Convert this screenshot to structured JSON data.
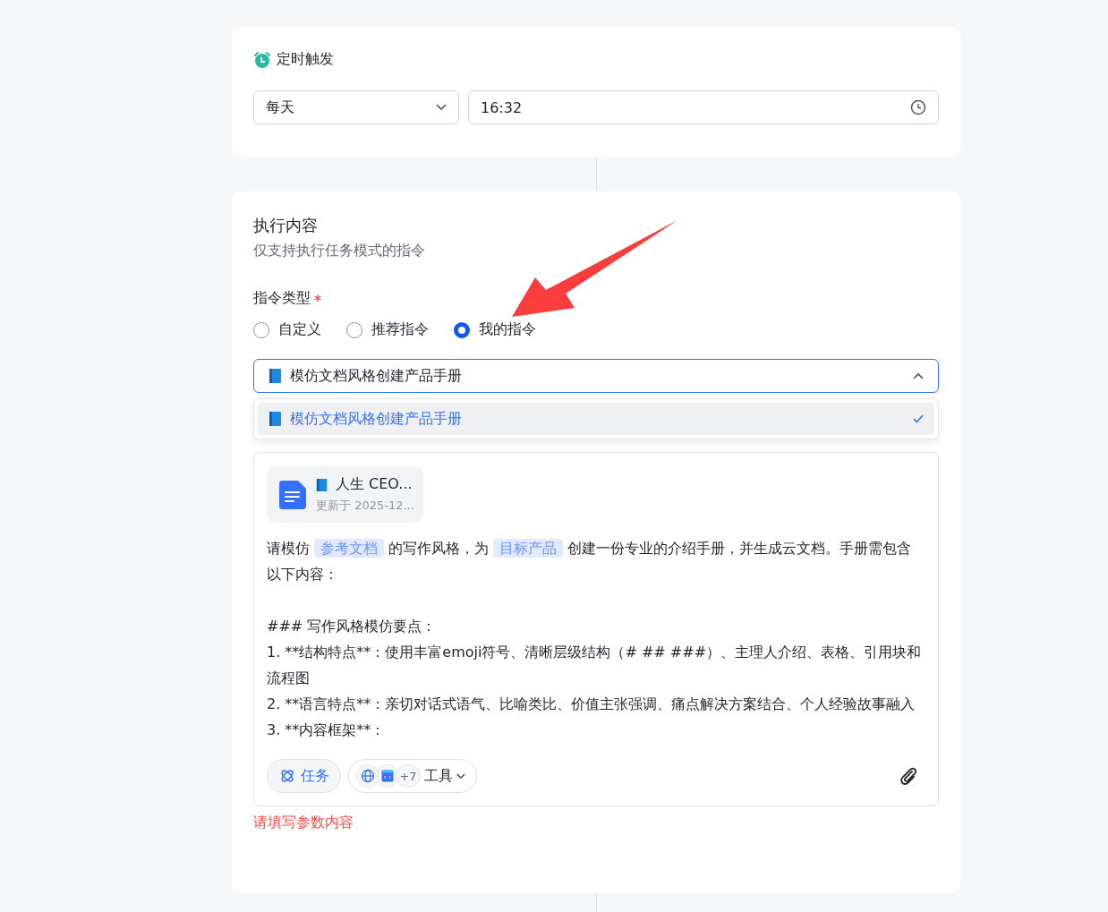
{
  "trigger": {
    "title": "定时触发",
    "frequency": "每天",
    "time": "16:32"
  },
  "content": {
    "title": "执行内容",
    "subtitle": "仅支持执行任务模式的指令",
    "type_label": "指令类型",
    "required": true,
    "types": [
      {
        "label": "自定义",
        "selected": false
      },
      {
        "label": "推荐指令",
        "selected": false
      },
      {
        "label": "我的指令",
        "selected": true
      }
    ],
    "select": {
      "value": "模仿文档风格创建产品手册",
      "expanded": true,
      "options": [
        {
          "label": "模仿文档风格创建产品手册",
          "selected": true
        }
      ]
    },
    "doc_card": {
      "title": "人生 CEO...",
      "updated": "更新于 2025-12..."
    },
    "prompt": [
      {
        "kind": "text",
        "text": "请模仿 "
      },
      {
        "kind": "chip",
        "text": "参考文档"
      },
      {
        "kind": "text",
        "text": " 的写作风格，为 "
      },
      {
        "kind": "chip",
        "text": "目标产品"
      },
      {
        "kind": "text",
        "text": " 创建一份专业的介绍手册，并生成云文档。手册需包含以下内容："
      }
    ],
    "lines": [
      "### 写作风格模仿要点：",
      "1. **结构特点**：使用丰富emoji符号、清晰层级结构（# ## ###）、主理人介绍、表格、引用块和流程图",
      "2. **语言特点**：亲切对话式语气、比喻类比、价值主张强调、痛点解决方案结合、个人经验故事融入",
      "3. **内容框架**："
    ],
    "task_button": "任务",
    "tools_count": "+7",
    "tools_label": "工具",
    "error": "请填写参数内容"
  }
}
